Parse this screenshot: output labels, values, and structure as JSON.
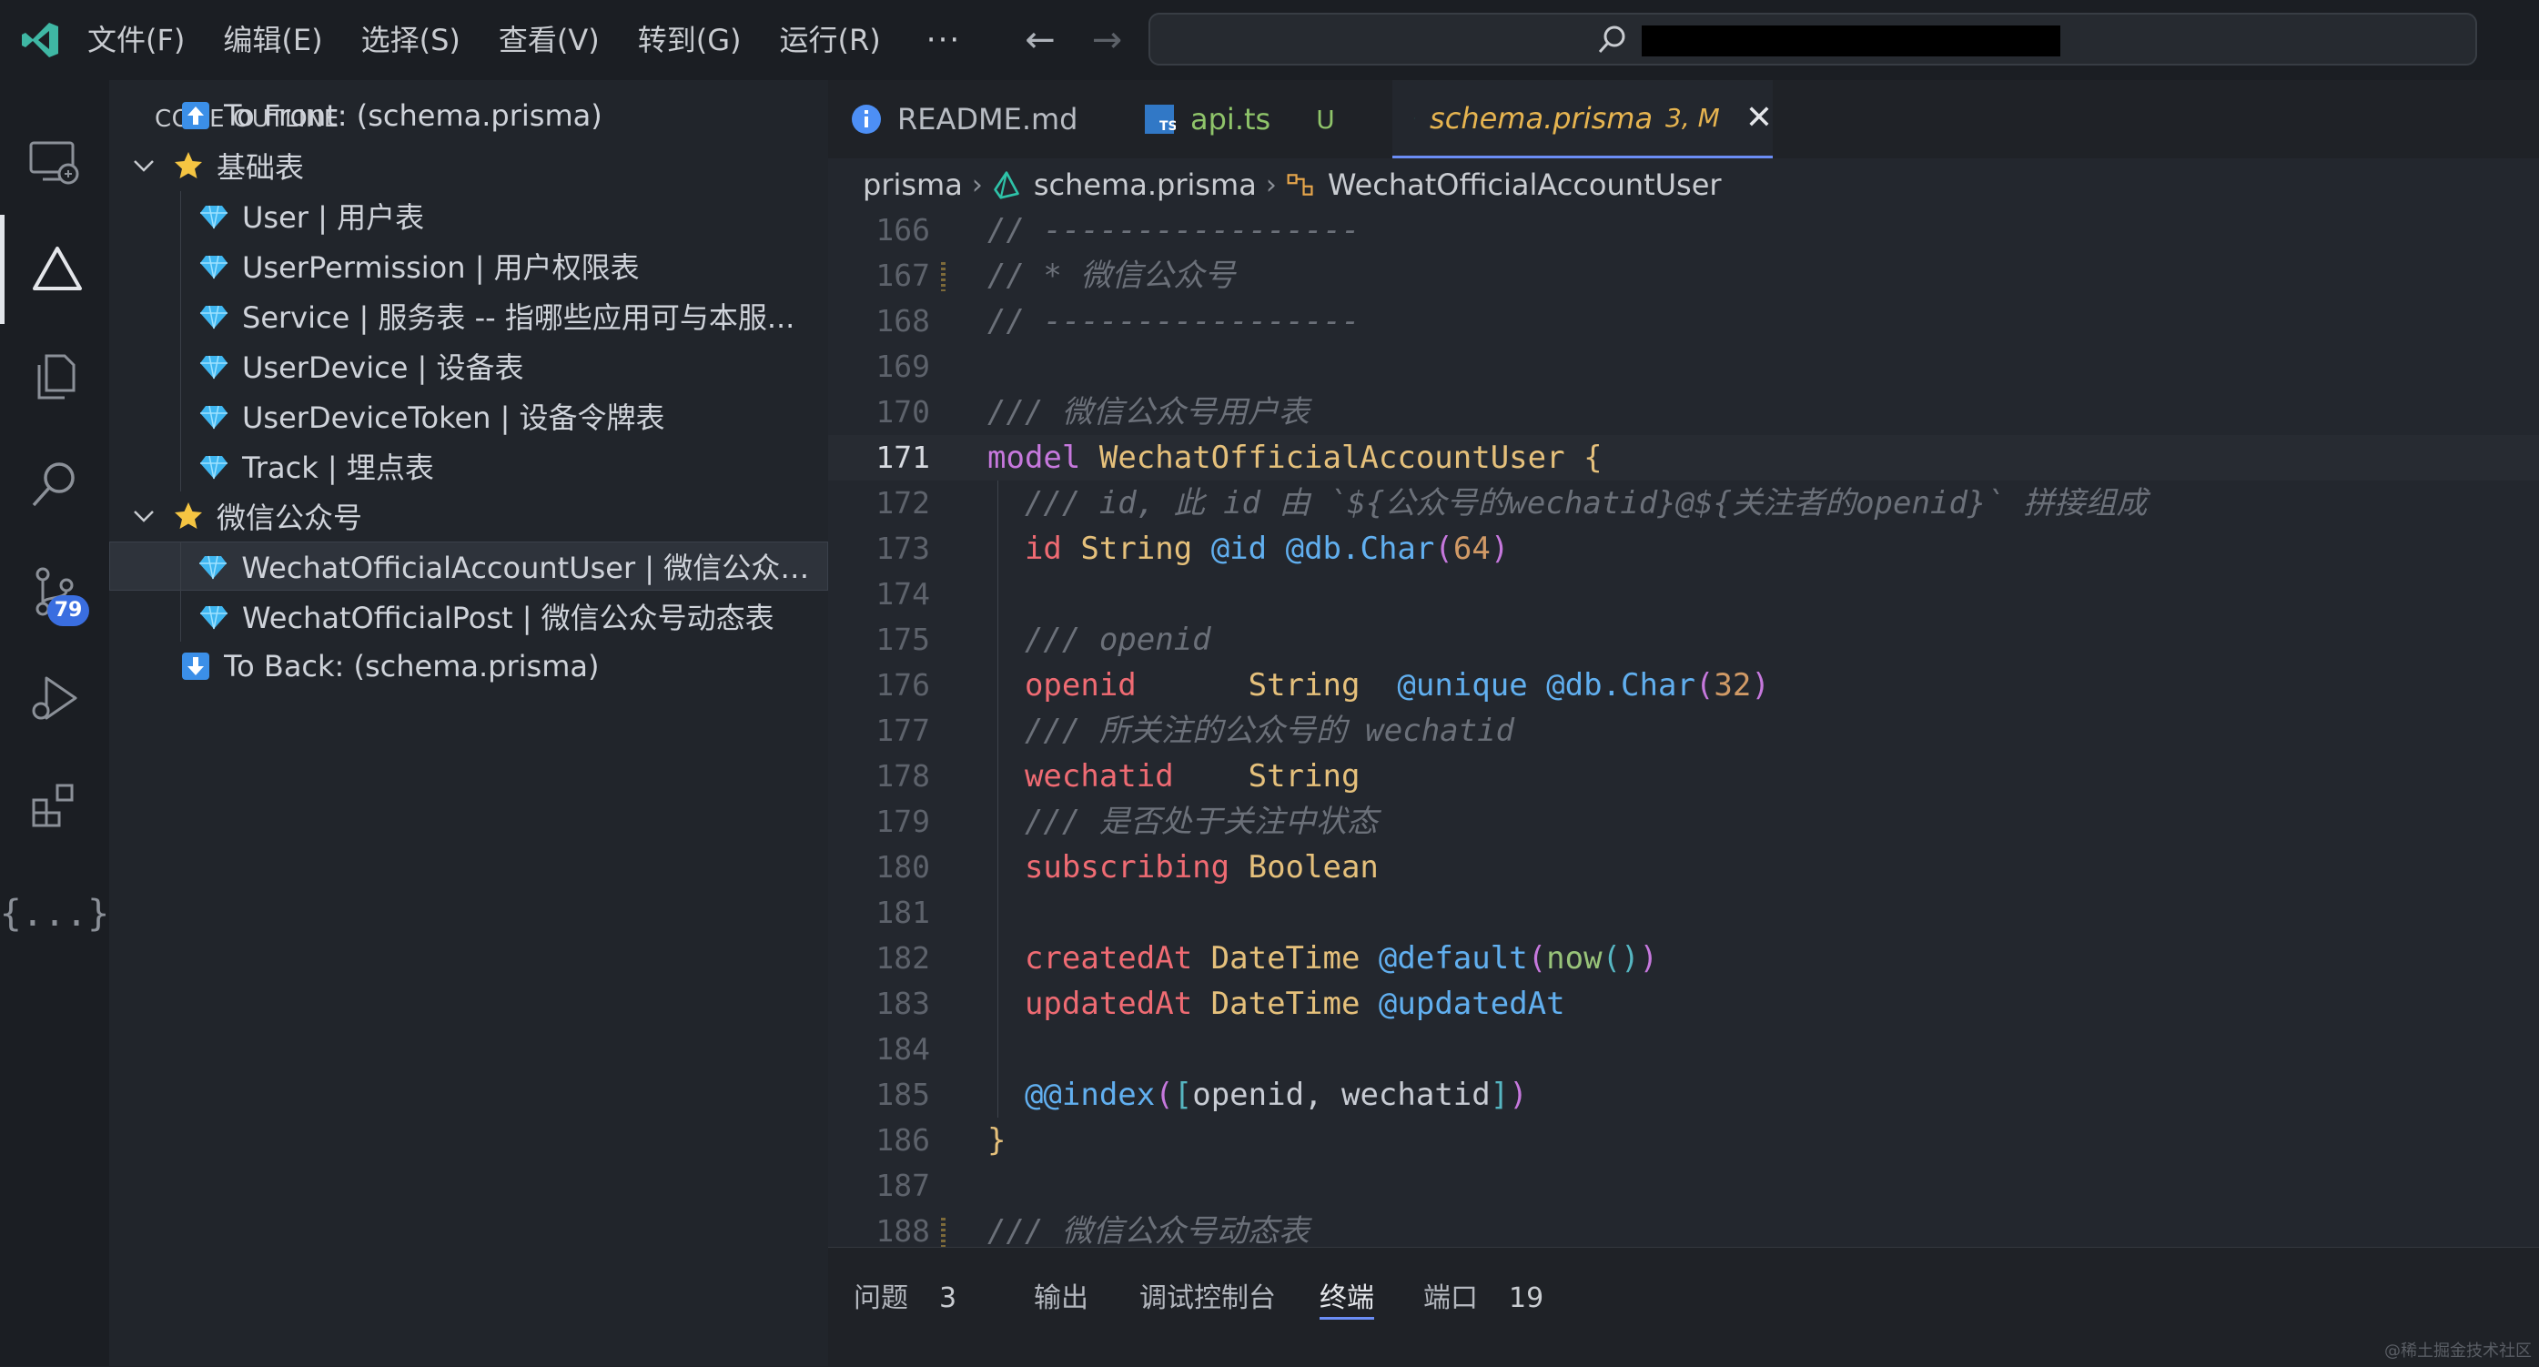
{
  "menu": {
    "items": [
      "文件(F)",
      "编辑(E)",
      "选择(S)",
      "查看(V)",
      "转到(G)",
      "运行(R)"
    ],
    "more": "···"
  },
  "nav": {
    "back": "←",
    "forward": "→"
  },
  "activity": {
    "scm_badge": "79",
    "json_glyph": "{...}"
  },
  "sidebar": {
    "title": "CODE OUTLINE",
    "rows": [
      {
        "label": "To Front: (schema.prisma)",
        "icon": "arrow-up-icon"
      },
      {
        "label": "基础表",
        "icon": "star-icon",
        "expanded": true
      },
      {
        "label": "User | 用户表",
        "icon": "gem-icon"
      },
      {
        "label": "UserPermission | 用户权限表",
        "icon": "gem-icon"
      },
      {
        "label": "Service | 服务表 -- 指哪些应用可与本服...",
        "icon": "gem-icon"
      },
      {
        "label": "UserDevice | 设备表",
        "icon": "gem-icon"
      },
      {
        "label": "UserDeviceToken | 设备令牌表",
        "icon": "gem-icon"
      },
      {
        "label": "Track | 埋点表",
        "icon": "gem-icon"
      },
      {
        "label": "微信公众号",
        "icon": "star-icon",
        "expanded": true
      },
      {
        "label": "WechatOfficialAccountUser | 微信公众号...",
        "icon": "gem-icon",
        "selected": true
      },
      {
        "label": "WechatOfficialPost | 微信公众号动态表",
        "icon": "gem-icon"
      },
      {
        "label": "To Back: (schema.prisma)",
        "icon": "arrow-down-icon"
      }
    ]
  },
  "tabs": {
    "readme": {
      "label": "README.md"
    },
    "api": {
      "label": "api.ts",
      "status": "U"
    },
    "schema": {
      "label": "schema.prisma",
      "status": "3, M",
      "close": "✕"
    }
  },
  "breadcrumb": {
    "folder": "prisma",
    "file": "schema.prisma",
    "symbol": "WechatOfficialAccountUser",
    "sep": "›"
  },
  "editor": {
    "current_line": 171,
    "lines": [
      {
        "n": "166",
        "text": "// -----------------"
      },
      {
        "n": "167",
        "text": "// * 微信公众号"
      },
      {
        "n": "168",
        "text": "// -----------------"
      },
      {
        "n": "169",
        "text": ""
      },
      {
        "n": "170",
        "text": "/// 微信公众号用户表"
      },
      {
        "n": "171",
        "kw": "model",
        "name": "WechatOfficialAccountUser",
        "brace": "{"
      },
      {
        "n": "172",
        "text": "  /// id, 此 id 由 `${公众号的wechatid}@${关注者的openid}` 拼接组成"
      },
      {
        "n": "173",
        "field": "id",
        "type": "String",
        "a1": "@id",
        "a2": "@db.Char",
        "arg": "64"
      },
      {
        "n": "174",
        "text": ""
      },
      {
        "n": "175",
        "text": "  /// openid"
      },
      {
        "n": "176",
        "field": "openid",
        "type": "String",
        "a1": "@unique",
        "a2": "@db.Char",
        "arg": "32"
      },
      {
        "n": "177",
        "text": "  /// 所关注的公众号的 wechatid"
      },
      {
        "n": "178",
        "field": "wechatid",
        "type": "String"
      },
      {
        "n": "179",
        "text": "  /// 是否处于关注中状态"
      },
      {
        "n": "180",
        "field": "subscribing",
        "type": "Boolean"
      },
      {
        "n": "181",
        "text": ""
      },
      {
        "n": "182",
        "field": "createdAt",
        "type": "DateTime",
        "a1": "@default",
        "fn": "now()"
      },
      {
        "n": "183",
        "field": "updatedAt",
        "type": "DateTime",
        "a1": "@updatedAt"
      },
      {
        "n": "184",
        "text": ""
      },
      {
        "n": "185",
        "index_attr": "@@index",
        "index_args": "openid, wechatid"
      },
      {
        "n": "186",
        "close": "}"
      },
      {
        "n": "187",
        "text": ""
      },
      {
        "n": "188",
        "text": "/// 微信公众号动态表"
      }
    ]
  },
  "panel": {
    "tabs": [
      {
        "label": "问题",
        "count": "3"
      },
      {
        "label": "输出"
      },
      {
        "label": "调试控制台"
      },
      {
        "label": "终端",
        "active": true
      },
      {
        "label": "端口",
        "count": "19"
      }
    ]
  },
  "watermark": "@稀土掘金技术社区",
  "colors": {
    "accent": "#6b8df5",
    "keyword": "#c678dd",
    "type": "#e5c07b",
    "field": "#ef6b73",
    "attribute": "#61afef",
    "comment": "#6b7079",
    "badge": "#3a6ee0"
  }
}
